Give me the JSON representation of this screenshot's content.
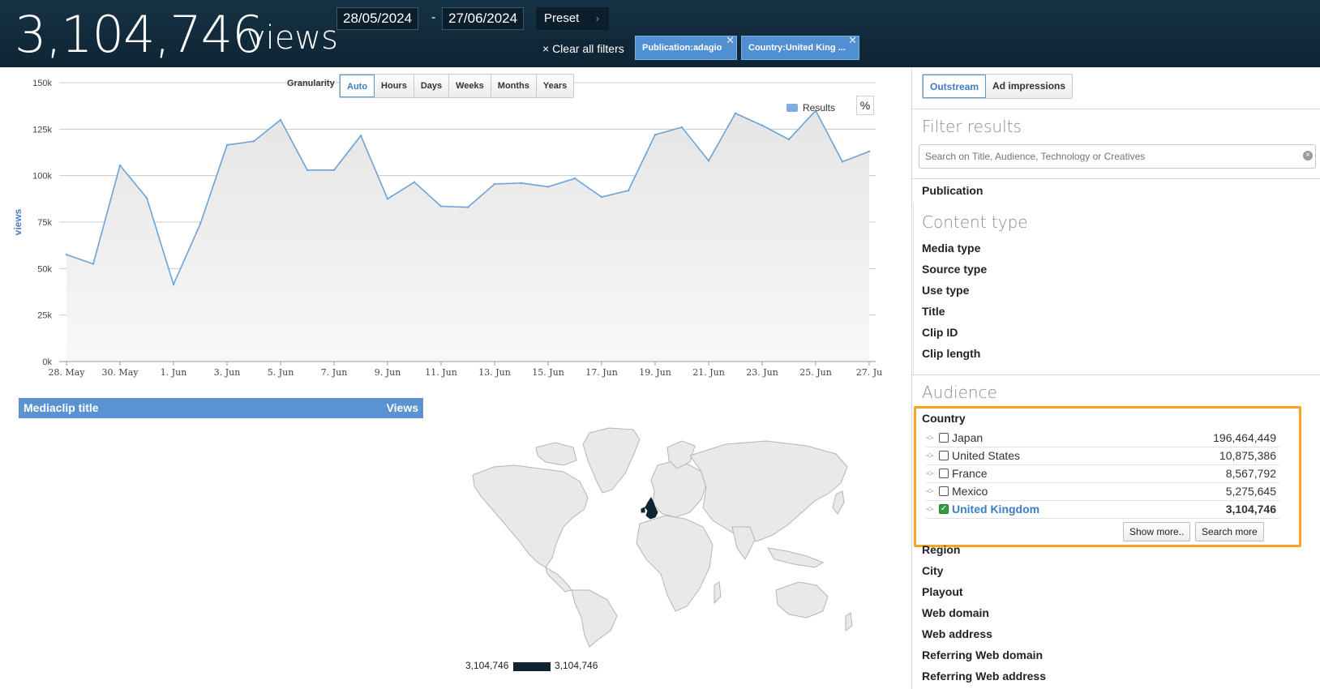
{
  "header": {
    "total_number": "3,104,746",
    "total_unit": "views",
    "date_from": "28/05/2024",
    "date_sep": "-",
    "date_to": "27/06/2024",
    "preset_label": "Preset",
    "clear_filters_label": "× Clear all filters",
    "filters": [
      {
        "label": "Publication:adagio"
      },
      {
        "label": "Country:United King ..."
      }
    ]
  },
  "granularity": {
    "label": "Granularity",
    "options": [
      "Auto",
      "Hours",
      "Days",
      "Weeks",
      "Months",
      "Years"
    ],
    "active": "Auto"
  },
  "chart_controls": {
    "percent_label": "%"
  },
  "chart_data": {
    "type": "area",
    "title": "",
    "xlabel": "",
    "ylabel": "views",
    "ylim": [
      0,
      150000
    ],
    "y_ticks": [
      "0k",
      "25k",
      "50k",
      "75k",
      "100k",
      "125k",
      "150k"
    ],
    "x_tick_labels": [
      "28. May",
      "30. May",
      "1. Jun",
      "3. Jun",
      "5. Jun",
      "7. Jun",
      "9. Jun",
      "11. Jun",
      "13. Jun",
      "15. Jun",
      "17. Jun",
      "19. Jun",
      "21. Jun",
      "23. Jun",
      "25. Jun",
      "27. Ju"
    ],
    "x": [
      "28. May",
      "29. May",
      "30. May",
      "31. May",
      "1. Jun",
      "2. Jun",
      "3. Jun",
      "4. Jun",
      "5. Jun",
      "6. Jun",
      "7. Jun",
      "8. Jun",
      "9. Jun",
      "10. Jun",
      "11. Jun",
      "12. Jun",
      "13. Jun",
      "14. Jun",
      "15. Jun",
      "16. Jun",
      "17. Jun",
      "18. Jun",
      "19. Jun",
      "20. Jun",
      "21. Jun",
      "22. Jun",
      "23. Jun",
      "24. Jun",
      "25. Jun",
      "26. Jun",
      "27. Jun"
    ],
    "series": [
      {
        "name": "Results",
        "values": [
          57500,
          52500,
          105500,
          88000,
          41500,
          74000,
          116500,
          118500,
          130000,
          103000,
          103000,
          121500,
          87500,
          96500,
          83500,
          83000,
          95500,
          96000,
          94000,
          98500,
          88500,
          92000,
          122000,
          126000,
          108000,
          133500,
          127000,
          119500,
          135000,
          107500,
          113000
        ]
      }
    ],
    "grid": true,
    "legend_position": "top-right",
    "line_color": "#6ca3d7",
    "fill_color": "#ececec"
  },
  "table": {
    "col_title": "Mediaclip title",
    "col_views": "Views"
  },
  "map": {
    "legend_min": "3,104,746",
    "legend_max": "3,104,746",
    "highlight_color": "#0e2534"
  },
  "right_panel": {
    "tabs": [
      "Outstream",
      "Ad impressions"
    ],
    "active_tab": "Outstream",
    "filter_results_title": "Filter results",
    "search_placeholder": "Search on Title, Audience, Technology or Creatives",
    "publication_label": "Publication",
    "content_type_title": "Content type",
    "content_type_facets": [
      "Media type",
      "Source type",
      "Use type",
      "Title",
      "Clip ID",
      "Clip length"
    ],
    "audience_title": "Audience",
    "country_label": "Country",
    "countries": [
      {
        "name": "Japan",
        "value": "196,464,449",
        "checked": false
      },
      {
        "name": "United States",
        "value": "10,875,386",
        "checked": false
      },
      {
        "name": "France",
        "value": "8,567,792",
        "checked": false
      },
      {
        "name": "Mexico",
        "value": "5,275,645",
        "checked": false
      },
      {
        "name": "United Kingdom",
        "value": "3,104,746",
        "checked": true
      }
    ],
    "show_more_label": "Show more..",
    "search_more_label": "Search more",
    "audience_facets": [
      "Region",
      "City",
      "Playout",
      "Web domain",
      "Web address",
      "Referring Web domain",
      "Referring Web address"
    ],
    "highlight_color": "#f5a623"
  }
}
